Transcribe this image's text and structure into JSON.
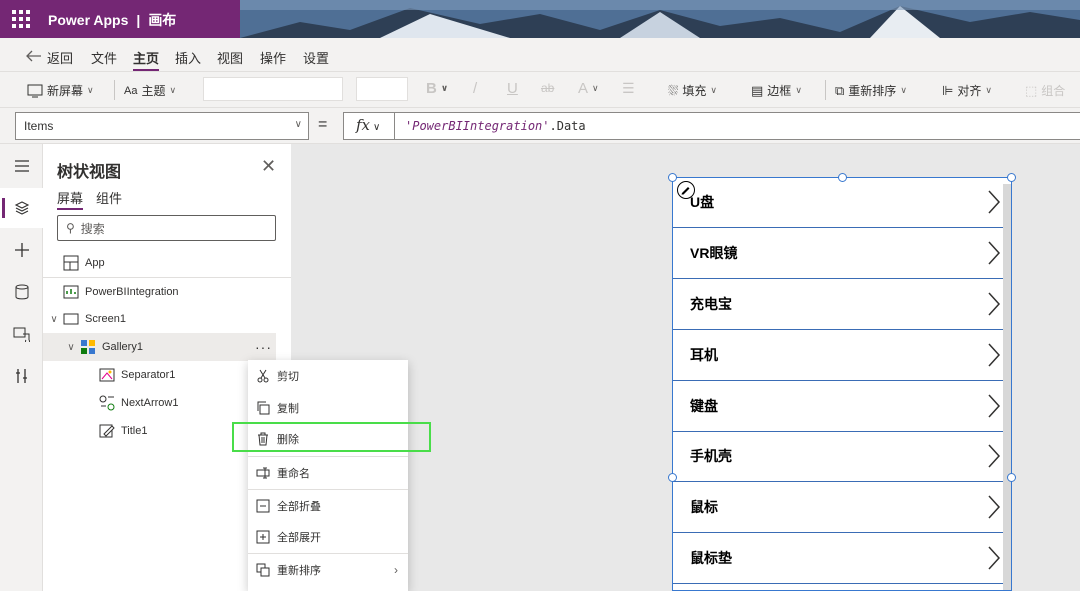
{
  "app": {
    "name": "Power Apps",
    "separator": "|",
    "context": "画布"
  },
  "menu": {
    "back": "返回",
    "items": [
      {
        "label": "文件",
        "active": false
      },
      {
        "label": "主页",
        "active": true
      },
      {
        "label": "插入",
        "active": false
      },
      {
        "label": "视图",
        "active": false
      },
      {
        "label": "操作",
        "active": false
      },
      {
        "label": "设置",
        "active": false
      }
    ]
  },
  "toolbar": {
    "new_screen": "新屏幕",
    "theme": "主题",
    "bold": "B",
    "italic": "/",
    "underline": "U",
    "strike": "ab",
    "font_color": "A",
    "fill": "填充",
    "border": "边框",
    "reorder": "重新排序",
    "align": "对齐",
    "group": "组合"
  },
  "formula_bar": {
    "property": "Items",
    "equals": "=",
    "fx": "fx",
    "formula_string": "'PowerBIIntegration'",
    "formula_rest": ".Data"
  },
  "tree_view": {
    "title": "树状视图",
    "tabs": [
      {
        "label": "屏幕",
        "active": true
      },
      {
        "label": "组件",
        "active": false
      }
    ],
    "search_placeholder": "搜索",
    "nodes": {
      "app": "App",
      "powerbi": "PowerBIIntegration",
      "screen": "Screen1",
      "gallery": "Gallery1",
      "gallery_more": "···",
      "separator": "Separator1",
      "next_arrow": "NextArrow1",
      "title": "Title1"
    }
  },
  "context_menu": {
    "items": [
      {
        "label": "剪切",
        "icon": "scissors-icon"
      },
      {
        "label": "复制",
        "icon": "copy-icon"
      },
      {
        "label": "删除",
        "icon": "trash-icon"
      },
      {
        "label": "重命名",
        "icon": "rename-icon"
      },
      {
        "label": "全部折叠",
        "icon": "collapse-all-icon"
      },
      {
        "label": "全部展开",
        "icon": "expand-all-icon"
      },
      {
        "label": "重新排序",
        "icon": "reorder-icon",
        "submenu": ">"
      }
    ],
    "highlighted": "删除"
  },
  "gallery": {
    "items": [
      "U盘",
      "VR眼镜",
      "充电宝",
      "耳机",
      "键盘",
      "手机壳",
      "鼠标",
      "鼠标垫"
    ]
  },
  "colors": {
    "brand": "#742774",
    "selection": "#3878cf",
    "highlight": "#49dd49",
    "row_divider": "#3a6cb5"
  }
}
